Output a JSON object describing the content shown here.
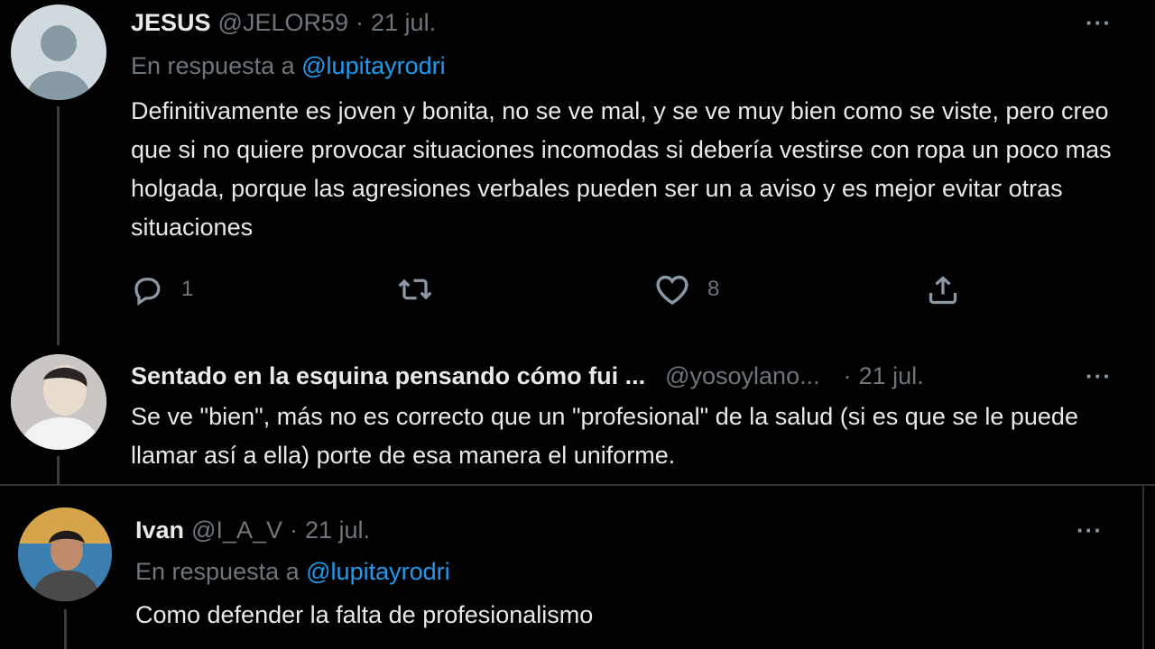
{
  "tweets": [
    {
      "name": "JESUS",
      "handle": "@JELOR59",
      "separator": "·",
      "date": "21 jul.",
      "reply_prefix": "En respuesta a",
      "reply_mention": "@lupitayrodri",
      "body": "Definitivamente es joven y bonita, no se ve mal, y se ve muy bien como se viste, pero creo que si no quiere provocar situaciones incomodas si debería vestirse con ropa un poco mas holgada, porque las agresiones verbales pueden ser un a aviso y es mejor evitar otras situaciones",
      "more": "···",
      "actions": {
        "reply_count": "1",
        "retweet_count": "",
        "like_count": "8"
      }
    },
    {
      "name": "Sentado en la esquina pensando cómo fui ...",
      "handle": "@yosoylano...",
      "separator": "·",
      "date": "21 jul.",
      "body": "Se ve \"bien\", más no es correcto que un \"profesional\" de la salud (si es que se le puede llamar así a ella) porte de esa manera el uniforme.",
      "more": "···"
    },
    {
      "name": "Ivan",
      "handle": "@I_A_V",
      "separator": "·",
      "date": "21 jul.",
      "reply_prefix": "En respuesta a",
      "reply_mention": "@lupitayrodri",
      "body": "Como defender la falta de profesionalismo",
      "more": "···"
    }
  ],
  "colors": {
    "background": "#000000",
    "text": "#e7e9ea",
    "muted": "#6e767d",
    "link": "#1d9bf0"
  }
}
